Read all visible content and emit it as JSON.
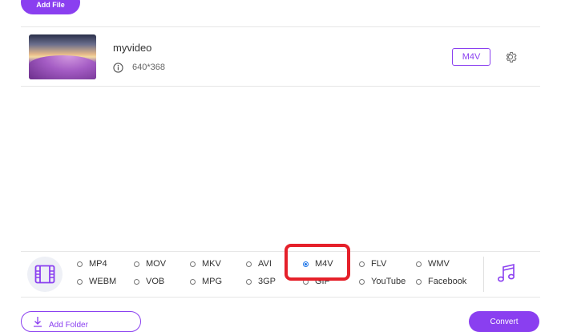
{
  "toolbar": {
    "add_file_label": "Add File"
  },
  "file": {
    "name": "myvideo",
    "dimensions": "640*368",
    "format": "M4V"
  },
  "formats": {
    "video_options": [
      {
        "label": "MP4",
        "selected": false
      },
      {
        "label": "MOV",
        "selected": false
      },
      {
        "label": "MKV",
        "selected": false
      },
      {
        "label": "AVI",
        "selected": false
      },
      {
        "label": "M4V",
        "selected": true
      },
      {
        "label": "FLV",
        "selected": false
      },
      {
        "label": "WMV",
        "selected": false
      },
      {
        "label": "WEBM",
        "selected": false
      },
      {
        "label": "VOB",
        "selected": false
      },
      {
        "label": "MPG",
        "selected": false
      },
      {
        "label": "3GP",
        "selected": false
      },
      {
        "label": "GIF",
        "selected": false
      },
      {
        "label": "YouTube",
        "selected": false
      },
      {
        "label": "Facebook",
        "selected": false
      }
    ]
  },
  "colors": {
    "accent": "#8a3ff0",
    "highlight": "#e5202a",
    "radio_selected": "#1a73e8"
  },
  "footer": {
    "add_folder_label": "Add Folder",
    "convert_label": "Convert"
  }
}
